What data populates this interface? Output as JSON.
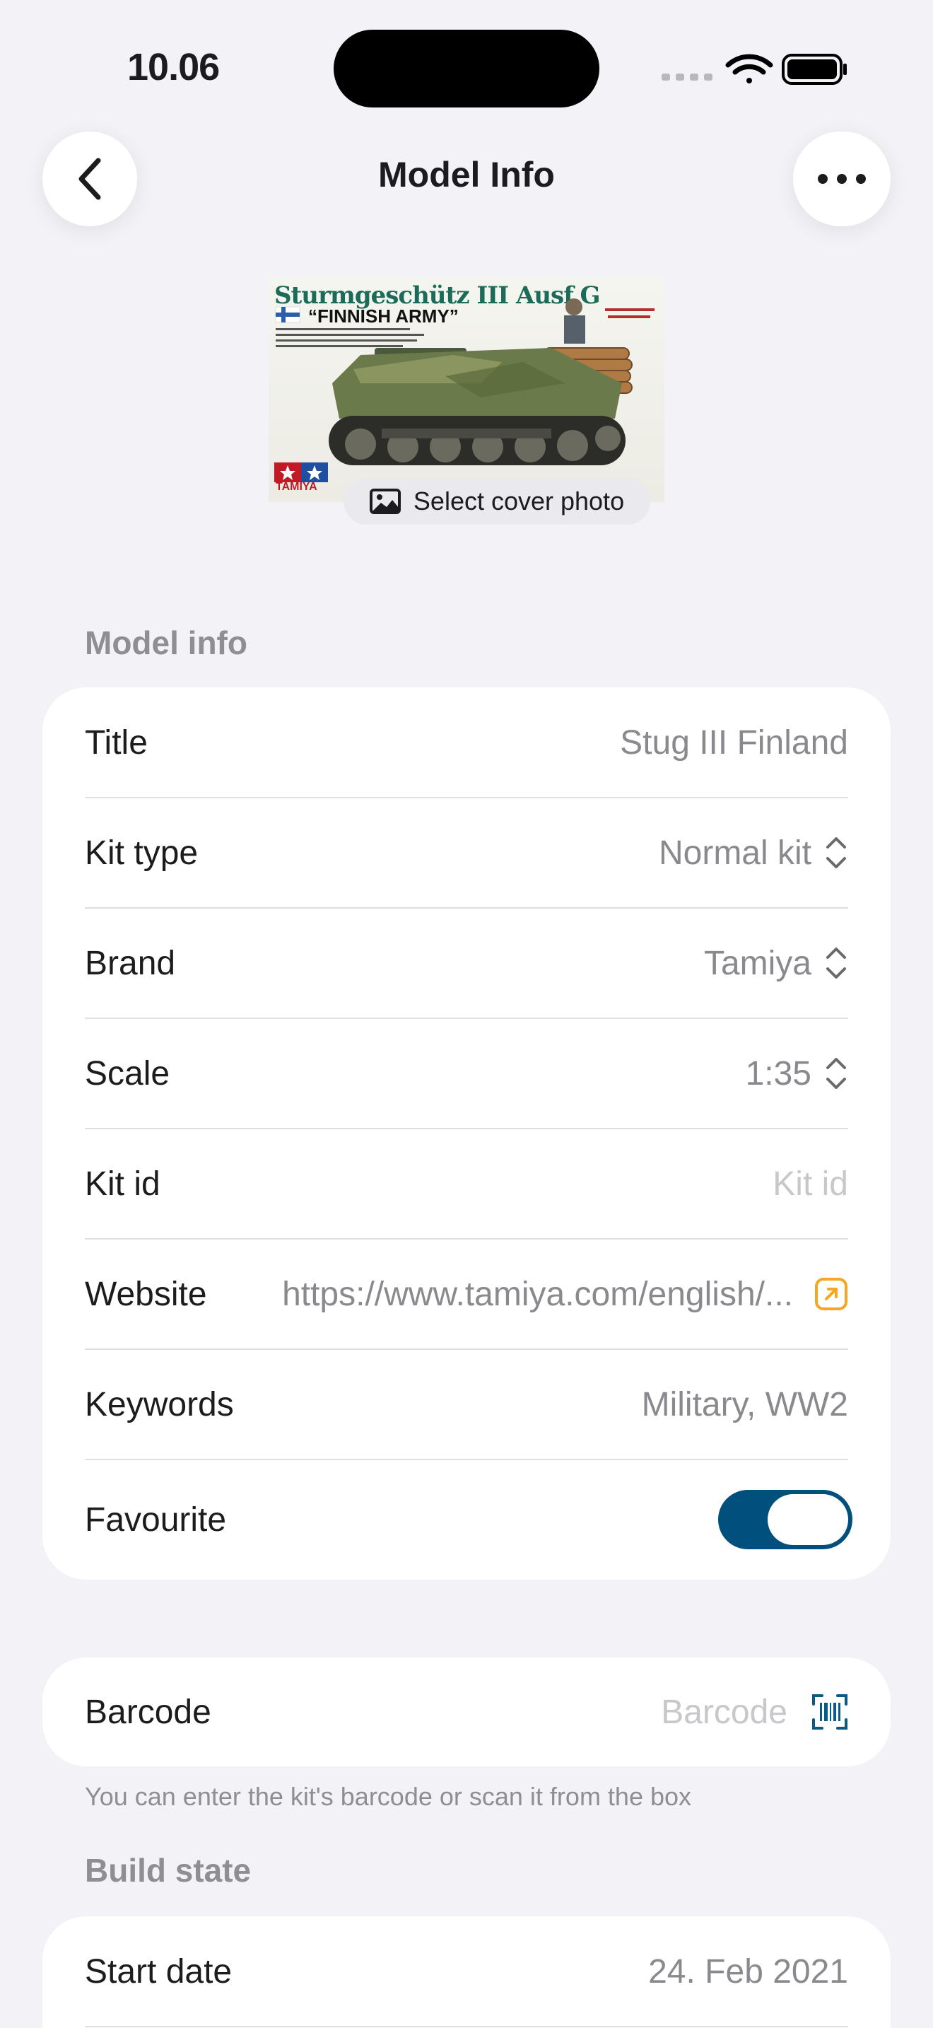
{
  "status_bar": {
    "time": "10.06"
  },
  "nav": {
    "title": "Model Info",
    "back_icon": "chevron-left-icon",
    "more_icon": "ellipsis-icon"
  },
  "cover": {
    "box_title": "Sturmgeschütz III Ausf.G",
    "box_subtitle": "“FINNISH ARMY”",
    "box_brand": "TAMIYA",
    "select_label": "Select cover photo"
  },
  "model_info": {
    "section_title": "Model info",
    "rows": [
      {
        "label": "Title",
        "value": "Stug III Finland"
      },
      {
        "label": "Kit type",
        "value": "Normal kit"
      },
      {
        "label": "Brand",
        "value": "Tamiya"
      },
      {
        "label": "Scale",
        "value": "1:35"
      },
      {
        "label": "Kit id",
        "placeholder": "Kit id"
      },
      {
        "label": "Website",
        "value": "https://www.tamiya.com/english/..."
      },
      {
        "label": "Keywords",
        "value": "Military, WW2"
      },
      {
        "label": "Favourite",
        "toggle": true
      }
    ]
  },
  "barcode": {
    "label": "Barcode",
    "placeholder": "Barcode",
    "note": "You can enter the kit's barcode or scan it from the box"
  },
  "build_state": {
    "section_title": "Build state",
    "rows": [
      {
        "label": "Start date",
        "value": "24. Feb 2021"
      }
    ]
  },
  "colors": {
    "toggle_on": "#004f7d",
    "link_icon": "#f5a623",
    "barcode_icon": "#0a5a86"
  }
}
